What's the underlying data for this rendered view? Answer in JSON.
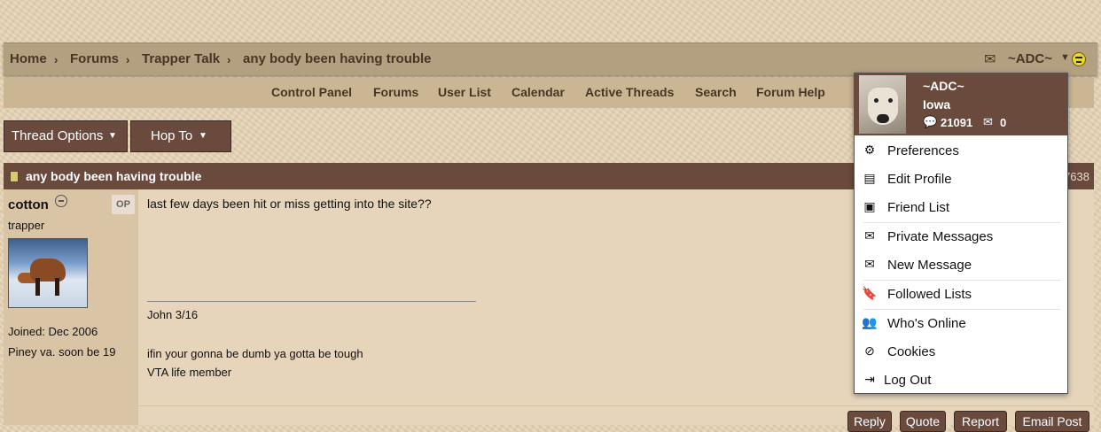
{
  "breadcrumb": {
    "items": [
      "Home",
      "Forums",
      "Trapper Talk",
      "any body been having trouble"
    ]
  },
  "account": {
    "username": "~ADC~",
    "envelope_icon": "envelope-icon",
    "status_icon": "smiley-icon"
  },
  "nav": {
    "items": [
      "Control Panel",
      "Forums",
      "User List",
      "Calendar",
      "Active Threads",
      "Search",
      "Forum Help"
    ]
  },
  "thread_options": {
    "label": "Thread Options",
    "hop_label": "Hop To"
  },
  "post": {
    "title": "any body been having trouble",
    "number_fragment": "7638",
    "author": {
      "name": "cotton",
      "op_badge": "OP",
      "title": "trapper",
      "joined": "Joined: Dec 2006",
      "location": "Piney va. soon be 19"
    },
    "body": "last few days been hit or miss getting into the site??",
    "signature": [
      "John 3/16",
      "ifin your gonna be dumb ya gotta be tough",
      "VTA life member"
    ],
    "actions": [
      "Reply",
      "Quote",
      "Report",
      "Email Post"
    ]
  },
  "dropdown": {
    "name": "~ADC~",
    "location": "Iowa",
    "post_count": "21091",
    "message_count": "0",
    "items": [
      {
        "label": "Preferences",
        "icon": "gear-icon"
      },
      {
        "label": "Edit Profile",
        "icon": "id-card-icon"
      },
      {
        "label": "Friend List",
        "icon": "address-book-icon"
      },
      {
        "label": "Private Messages",
        "icon": "envelope-open-icon"
      },
      {
        "label": "New Message",
        "icon": "envelope-icon"
      },
      {
        "label": "Followed Lists",
        "icon": "bookmark-icon"
      },
      {
        "label": "Who's Online",
        "icon": "users-icon"
      },
      {
        "label": "Cookies",
        "icon": "cookie-bite-icon"
      },
      {
        "label": "Log Out",
        "icon": "sign-out-icon"
      }
    ]
  },
  "colors": {
    "accent_brown": "#6b4a3e",
    "breadcrumb_bar": "#b3a080",
    "nav_bar": "#cbb694",
    "text_brown": "#4a3524"
  }
}
